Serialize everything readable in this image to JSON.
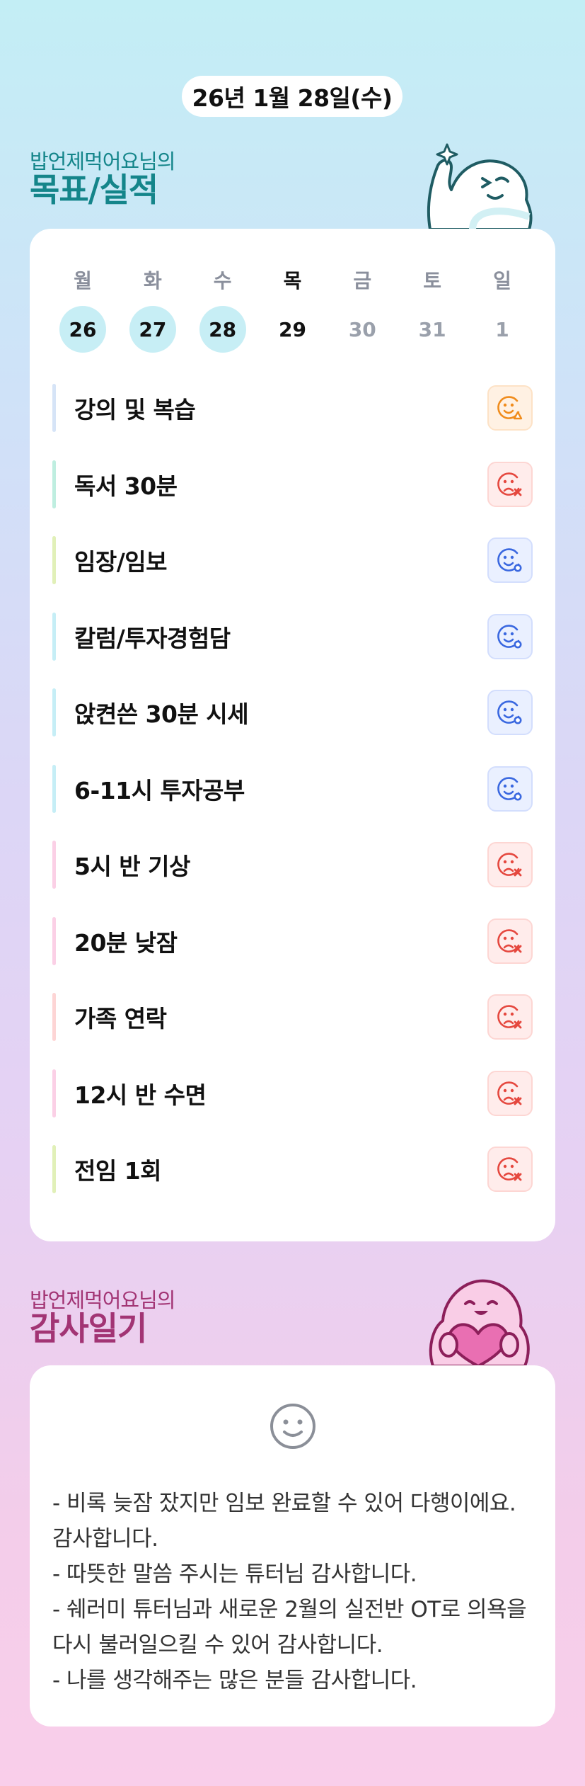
{
  "date_label": "26년 1월 28일(수)",
  "goals_section": {
    "owner": "밥언제먹어요님의",
    "title": "목표/실적"
  },
  "calendar": {
    "weekdays": [
      "월",
      "화",
      "수",
      "목",
      "금",
      "토",
      "일"
    ],
    "days": [
      {
        "num": "26",
        "state": "done"
      },
      {
        "num": "27",
        "state": "done"
      },
      {
        "num": "28",
        "state": "done"
      },
      {
        "num": "29",
        "state": "today"
      },
      {
        "num": "30",
        "state": "future"
      },
      {
        "num": "31",
        "state": "future"
      },
      {
        "num": "1",
        "state": "future"
      }
    ]
  },
  "goals": [
    {
      "label": "강의 및 복습",
      "result": "partial",
      "bar_color": "#d6e4f7"
    },
    {
      "label": "독서 30분",
      "result": "fail",
      "bar_color": "#bfeee0"
    },
    {
      "label": "임장/임보",
      "result": "success",
      "bar_color": "#e1f0b8"
    },
    {
      "label": "칼럼/투자경험담",
      "result": "success",
      "bar_color": "#c6eef6"
    },
    {
      "label": "앉켠쓴 30분 시세",
      "result": "success",
      "bar_color": "#c6eef6"
    },
    {
      "label": "6-11시 투자공부",
      "result": "success",
      "bar_color": "#c6eef6"
    },
    {
      "label": "5시 반 기상",
      "result": "fail",
      "bar_color": "#fbd0e6"
    },
    {
      "label": "20분 낮잠",
      "result": "fail",
      "bar_color": "#fbd0e6"
    },
    {
      "label": "가족 연락",
      "result": "fail",
      "bar_color": "#fdd5d5"
    },
    {
      "label": "12시 반 수면",
      "result": "fail",
      "bar_color": "#fbd0e6"
    },
    {
      "label": "전임 1회",
      "result": "fail",
      "bar_color": "#e1f0b8"
    }
  ],
  "result_colors": {
    "partial": "#f08c1c",
    "fail": "#e5483f",
    "success": "#3a68e0"
  },
  "gratitude_section": {
    "owner": "밥언제먹어요님의",
    "title": "감사일기"
  },
  "gratitude_lines": [
    "- 비록 늦잠 잤지만 임보 완료할 수 있어 다행이에요. 감사합니다.",
    "- 따뜻한 말씀 주시는 튜터님 감사합니다.",
    "- 쉐러미 튜터님과 새로운 2월의 실전반 OT로 의욕을 다시 불러일으킬 수 있어 감사합니다.",
    "- 나를 생각해주는 많은 분들 감사합니다."
  ],
  "icons": {
    "goals_mascot": "waving-ghost-mascot-icon",
    "gratitude_mascot": "heart-holding-mascot-icon",
    "journal_face": "smiley-face-icon"
  }
}
